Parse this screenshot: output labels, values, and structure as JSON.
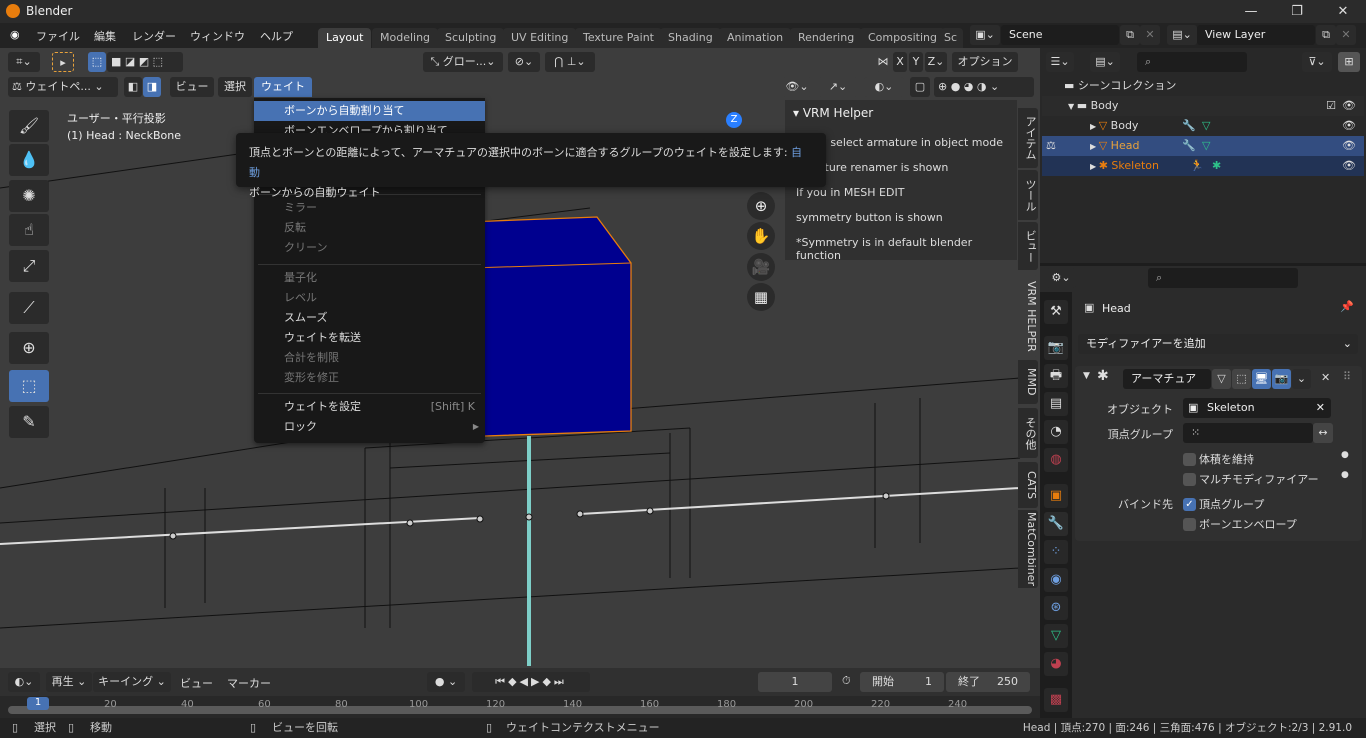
{
  "window": {
    "title": "Blender",
    "controls": [
      "—",
      "❐",
      "✕"
    ]
  },
  "menubar": {
    "items": [
      "ファイル",
      "編集",
      "レンダー",
      "ウィンドウ",
      "ヘルプ"
    ],
    "workspaces": [
      "Layout",
      "Modeling",
      "Sculpting",
      "UV Editing",
      "Texture Paint",
      "Shading",
      "Animation",
      "Rendering",
      "Compositing",
      "Sc"
    ],
    "active_workspace": "Layout",
    "scene": "Scene",
    "view_layer": "View Layer"
  },
  "viewport": {
    "header": {
      "transform_orientation": "グロー...",
      "axes": [
        "X",
        "Y",
        "Z"
      ],
      "options": "オプション"
    },
    "header2": {
      "mode": "ウェイトペ...",
      "menus": [
        "ビュー",
        "選択",
        "ウェイト"
      ]
    },
    "overlay_text": {
      "projection": "ユーザー・平行投影",
      "object": "(1) Head : NeckBone"
    },
    "gizmo_axis": "Z"
  },
  "weight_menu": {
    "items": [
      {
        "label": "ボーンから自動割り当て",
        "state": "highlighted"
      },
      {
        "label": "ボーンエンベロープから割り当て",
        "state": "normal"
      },
      {
        "label": "ミラー",
        "state": "disabled",
        "sep_before": true
      },
      {
        "label": "反転",
        "state": "disabled"
      },
      {
        "label": "クリーン",
        "state": "disabled"
      },
      {
        "label": "量子化",
        "state": "disabled",
        "sep_before": true
      },
      {
        "label": "レベル",
        "state": "disabled"
      },
      {
        "label": "スムーズ",
        "state": "normal"
      },
      {
        "label": "ウェイトを転送",
        "state": "normal"
      },
      {
        "label": "合計を制限",
        "state": "disabled"
      },
      {
        "label": "変形を修正",
        "state": "disabled"
      },
      {
        "label": "ウェイトを設定",
        "state": "normal",
        "shortcut": "[Shift] K",
        "sep_before": true
      },
      {
        "label": "ロック",
        "state": "normal",
        "submenu": true
      }
    ]
  },
  "tooltip": {
    "description": "頂点とボーンとの距離によって、アーマチュアの選択中のボーンに適合するグループのウェイトを設定します:",
    "hint": "自動",
    "subtitle": "ボーンからの自動ウェイト"
  },
  "vrm_helper": {
    "title": "VRM Helper",
    "lines": [
      "If you select armature in object mode",
      "armature renamer is shown",
      "If you in MESH EDIT",
      "symmetry button is shown",
      "*Symmetry is in default blender function"
    ]
  },
  "side_tabs": [
    "アイテム",
    "ツール",
    "ビュー",
    "VRM HELPER",
    "MMD",
    "その他",
    "CATS",
    "MatCombiner"
  ],
  "outliner": {
    "root": "シーンコレクション",
    "collection": "Body",
    "objects": [
      {
        "name": "Body",
        "color": "#dddddd"
      },
      {
        "name": "Head",
        "color": "#e9a23b"
      },
      {
        "name": "Skeleton",
        "color": "#e87d0d"
      }
    ]
  },
  "properties": {
    "object_name": "Head",
    "add_modifier": "モディファイアーを追加",
    "modifier": {
      "name": "アーマチュア",
      "object_label": "オブジェクト",
      "object_value": "Skeleton",
      "vgroup_label": "頂点グループ",
      "preserve_volume": "体積を維持",
      "multi_modifier": "マルチモディファイアー",
      "bind_to_label": "バインド先",
      "bind_vgroups": "頂点グループ",
      "bind_envelopes": "ボーンエンベロープ",
      "preserve_volume_checked": false,
      "multi_modifier_checked": false,
      "bind_vgroups_checked": true,
      "bind_envelopes_checked": false
    }
  },
  "timeline": {
    "menus": [
      "再生",
      "キーイング",
      "ビュー",
      "マーカー"
    ],
    "current_frame": "1",
    "start_label": "開始",
    "start": "1",
    "end_label": "終了",
    "end": "250",
    "ticks": [
      "1",
      "20",
      "40",
      "60",
      "80",
      "100",
      "120",
      "140",
      "160",
      "180",
      "200",
      "220",
      "240"
    ]
  },
  "status": {
    "select": "選択",
    "move": "移動",
    "rotate": "ビューを回転",
    "context": "ウェイトコンテクストメニュー",
    "stats": "Head | 頂点:270 | 面:246 | 三角面:476 | オブジェクト:2/3 | 2.91.0"
  },
  "colors": {
    "accent": "#4772b3",
    "orange": "#e87d0d",
    "cube": "#00008f"
  }
}
